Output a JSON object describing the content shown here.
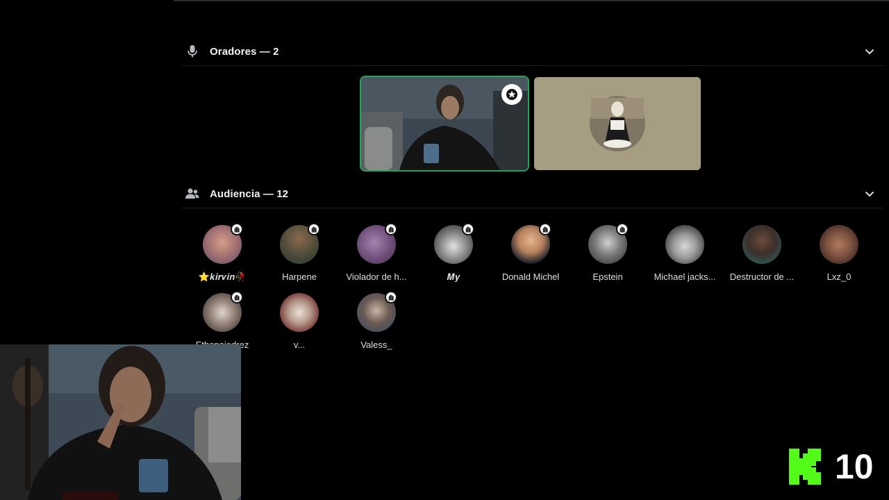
{
  "speakers": {
    "header": "Oradores — 2",
    "icon": "microphone-icon"
  },
  "audience": {
    "header": "Audiencia — 12",
    "icon": "users-icon",
    "members": [
      {
        "name": "⭐𝒌𝒊𝒓𝒗𝒊𝒏🥀"
      },
      {
        "name": "Harpene"
      },
      {
        "name": "Violador de h..."
      },
      {
        "name": "𝑴𝒚"
      },
      {
        "name": "Donald Michel"
      },
      {
        "name": "Epstein"
      },
      {
        "name": "Michael jacks..."
      },
      {
        "name": "Destructor de ..."
      },
      {
        "name": "Lxz_0"
      },
      {
        "name": "Ethanajedrez"
      },
      {
        "name": "v..."
      },
      {
        "name": "Valess_"
      }
    ]
  },
  "overlay": {
    "kick_count": "10"
  },
  "colors": {
    "background": "#000000",
    "speaking_ring": "#23a55a",
    "kick_green": "#53fc18"
  }
}
